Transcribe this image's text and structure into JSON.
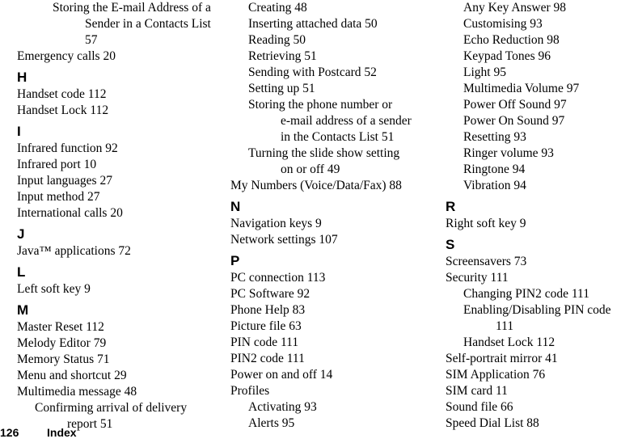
{
  "page": {
    "kind": "book-index-page",
    "background_color": "#ffffff",
    "text_color": "#000000"
  },
  "footer": {
    "page_number": "126",
    "section_name": "Index"
  },
  "columns": [
    {
      "id": "column-1",
      "blocks": [
        {
          "type": "entry",
          "level": 2,
          "text": "Storing the E-mail Address of a"
        },
        {
          "type": "entry",
          "level": "cont2",
          "text": "Sender in a Contacts List"
        },
        {
          "type": "entry",
          "level": "cont2",
          "text": "57"
        },
        {
          "type": "entry",
          "level": 0,
          "text": "Emergency calls 20"
        },
        {
          "type": "letter",
          "text": "H"
        },
        {
          "type": "entry",
          "level": 0,
          "text": "Handset code 112"
        },
        {
          "type": "entry",
          "level": 0,
          "text": "Handset Lock 112"
        },
        {
          "type": "letter",
          "text": "I"
        },
        {
          "type": "entry",
          "level": 0,
          "text": "Infrared function 92"
        },
        {
          "type": "entry",
          "level": 0,
          "text": "Infrared port 10"
        },
        {
          "type": "entry",
          "level": 0,
          "text": "Input languages 27"
        },
        {
          "type": "entry",
          "level": 0,
          "text": "Input method 27"
        },
        {
          "type": "entry",
          "level": 0,
          "text": "International calls 20"
        },
        {
          "type": "letter",
          "text": "J"
        },
        {
          "type": "entry",
          "level": 0,
          "text": "Java™ applications 72"
        },
        {
          "type": "letter",
          "text": "L"
        },
        {
          "type": "entry",
          "level": 0,
          "text": "Left soft key 9"
        },
        {
          "type": "letter",
          "text": "M"
        },
        {
          "type": "entry",
          "level": 0,
          "text": "Master Reset 112"
        },
        {
          "type": "entry",
          "level": 0,
          "text": "Melody Editor 79"
        },
        {
          "type": "entry",
          "level": 0,
          "text": "Memory Status 71"
        },
        {
          "type": "entry",
          "level": 0,
          "text": "Menu and shortcut 29"
        },
        {
          "type": "entry",
          "level": 0,
          "text": "Multimedia message 48"
        },
        {
          "type": "entry",
          "level": 1,
          "text": "Confirming arrival of delivery"
        },
        {
          "type": "entry",
          "level": "cont1",
          "text": "report 51"
        }
      ]
    },
    {
      "id": "column-2",
      "blocks": [
        {
          "type": "entry",
          "level": 1,
          "text": "Creating 48"
        },
        {
          "type": "entry",
          "level": 1,
          "text": "Inserting attached data 50"
        },
        {
          "type": "entry",
          "level": 1,
          "text": "Reading 50"
        },
        {
          "type": "entry",
          "level": 1,
          "text": "Retrieving 51"
        },
        {
          "type": "entry",
          "level": 1,
          "text": "Sending with Postcard 52"
        },
        {
          "type": "entry",
          "level": 1,
          "text": "Setting up 51"
        },
        {
          "type": "entry",
          "level": 1,
          "text": "Storing the phone number or"
        },
        {
          "type": "entry",
          "level": "cont1",
          "text": "e-mail address of a sender"
        },
        {
          "type": "entry",
          "level": "cont1",
          "text": "in the Contacts List 51"
        },
        {
          "type": "entry",
          "level": 1,
          "text": "Turning the slide show setting"
        },
        {
          "type": "entry",
          "level": "cont1",
          "text": "on or off 49"
        },
        {
          "type": "entry",
          "level": 0,
          "text": "My Numbers (Voice/Data/Fax) 88"
        },
        {
          "type": "letter",
          "text": "N"
        },
        {
          "type": "entry",
          "level": 0,
          "text": "Navigation keys 9"
        },
        {
          "type": "entry",
          "level": 0,
          "text": "Network settings 107"
        },
        {
          "type": "letter",
          "text": "P"
        },
        {
          "type": "entry",
          "level": 0,
          "text": "PC connection 113"
        },
        {
          "type": "entry",
          "level": 0,
          "text": "PC Software 92"
        },
        {
          "type": "entry",
          "level": 0,
          "text": "Phone Help 83"
        },
        {
          "type": "entry",
          "level": 0,
          "text": "Picture file 63"
        },
        {
          "type": "entry",
          "level": 0,
          "text": "PIN code 111"
        },
        {
          "type": "entry",
          "level": 0,
          "text": "PIN2 code 111"
        },
        {
          "type": "entry",
          "level": 0,
          "text": "Power on and off 14"
        },
        {
          "type": "entry",
          "level": 0,
          "text": "Profiles"
        },
        {
          "type": "entry",
          "level": 1,
          "text": "Activating 93"
        },
        {
          "type": "entry",
          "level": 1,
          "text": "Alerts 95"
        }
      ]
    },
    {
      "id": "column-3",
      "blocks": [
        {
          "type": "entry",
          "level": 1,
          "text": "Any Key Answer 98"
        },
        {
          "type": "entry",
          "level": 1,
          "text": "Customising 93"
        },
        {
          "type": "entry",
          "level": 1,
          "text": "Echo Reduction 98"
        },
        {
          "type": "entry",
          "level": 1,
          "text": "Keypad Tones 96"
        },
        {
          "type": "entry",
          "level": 1,
          "text": "Light 95"
        },
        {
          "type": "entry",
          "level": 1,
          "text": "Multimedia Volume 97"
        },
        {
          "type": "entry",
          "level": 1,
          "text": "Power Off Sound 97"
        },
        {
          "type": "entry",
          "level": 1,
          "text": "Power On Sound 97"
        },
        {
          "type": "entry",
          "level": 1,
          "text": "Resetting 93"
        },
        {
          "type": "entry",
          "level": 1,
          "text": "Ringer volume 93"
        },
        {
          "type": "entry",
          "level": 1,
          "text": "Ringtone 94"
        },
        {
          "type": "entry",
          "level": 1,
          "text": "Vibration 94"
        },
        {
          "type": "letter",
          "text": "R"
        },
        {
          "type": "entry",
          "level": 0,
          "text": "Right soft key 9"
        },
        {
          "type": "letter",
          "text": "S"
        },
        {
          "type": "entry",
          "level": 0,
          "text": "Screensavers 73"
        },
        {
          "type": "entry",
          "level": 0,
          "text": "Security 111"
        },
        {
          "type": "entry",
          "level": 1,
          "text": "Changing PIN2 code 111"
        },
        {
          "type": "entry",
          "level": 1,
          "text": "Enabling/Disabling PIN code"
        },
        {
          "type": "entry",
          "level": "cont1",
          "text": "111"
        },
        {
          "type": "entry",
          "level": 1,
          "text": "Handset Lock 112"
        },
        {
          "type": "entry",
          "level": 0,
          "text": "Self-portrait mirror 41"
        },
        {
          "type": "entry",
          "level": 0,
          "text": "SIM Application 76"
        },
        {
          "type": "entry",
          "level": 0,
          "text": "SIM card 11"
        },
        {
          "type": "entry",
          "level": 0,
          "text": "Sound file 66"
        },
        {
          "type": "entry",
          "level": 0,
          "text": "Speed Dial List 88"
        }
      ]
    }
  ]
}
